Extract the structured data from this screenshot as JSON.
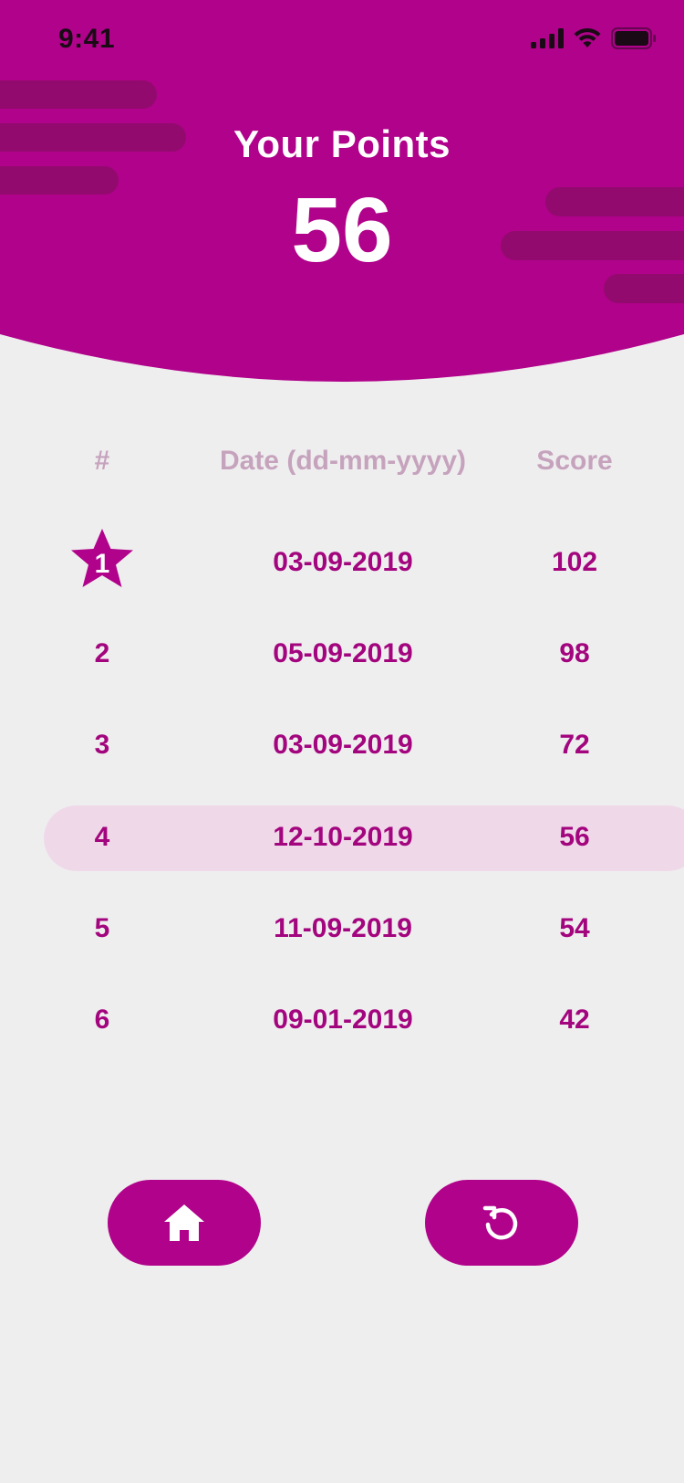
{
  "status_bar": {
    "time": "9:41"
  },
  "header": {
    "title": "Your Points",
    "points": "56"
  },
  "table": {
    "columns": [
      "#",
      "Date (dd-mm-yyyy)",
      "Score"
    ],
    "rows": [
      {
        "rank": "1",
        "date": "03-09-2019",
        "score": "102",
        "starred": true
      },
      {
        "rank": "2",
        "date": "05-09-2019",
        "score": "98"
      },
      {
        "rank": "3",
        "date": "03-09-2019",
        "score": "72"
      },
      {
        "rank": "4",
        "date": "12-10-2019",
        "score": "56",
        "current": true
      },
      {
        "rank": "5",
        "date": "11-09-2019",
        "score": "54"
      },
      {
        "rank": "6",
        "date": "09-01-2019",
        "score": "42"
      }
    ]
  },
  "buttons": {
    "home_icon": "home-icon",
    "replay_icon": "replay-icon"
  },
  "colors": {
    "brand": "#b0028a",
    "brand_dark": "#8f0a6e",
    "text_accent": "#a3057e",
    "header_text_muted": "#c6a3bd",
    "highlight_row": "#efd9e9",
    "background": "#efeeef"
  }
}
